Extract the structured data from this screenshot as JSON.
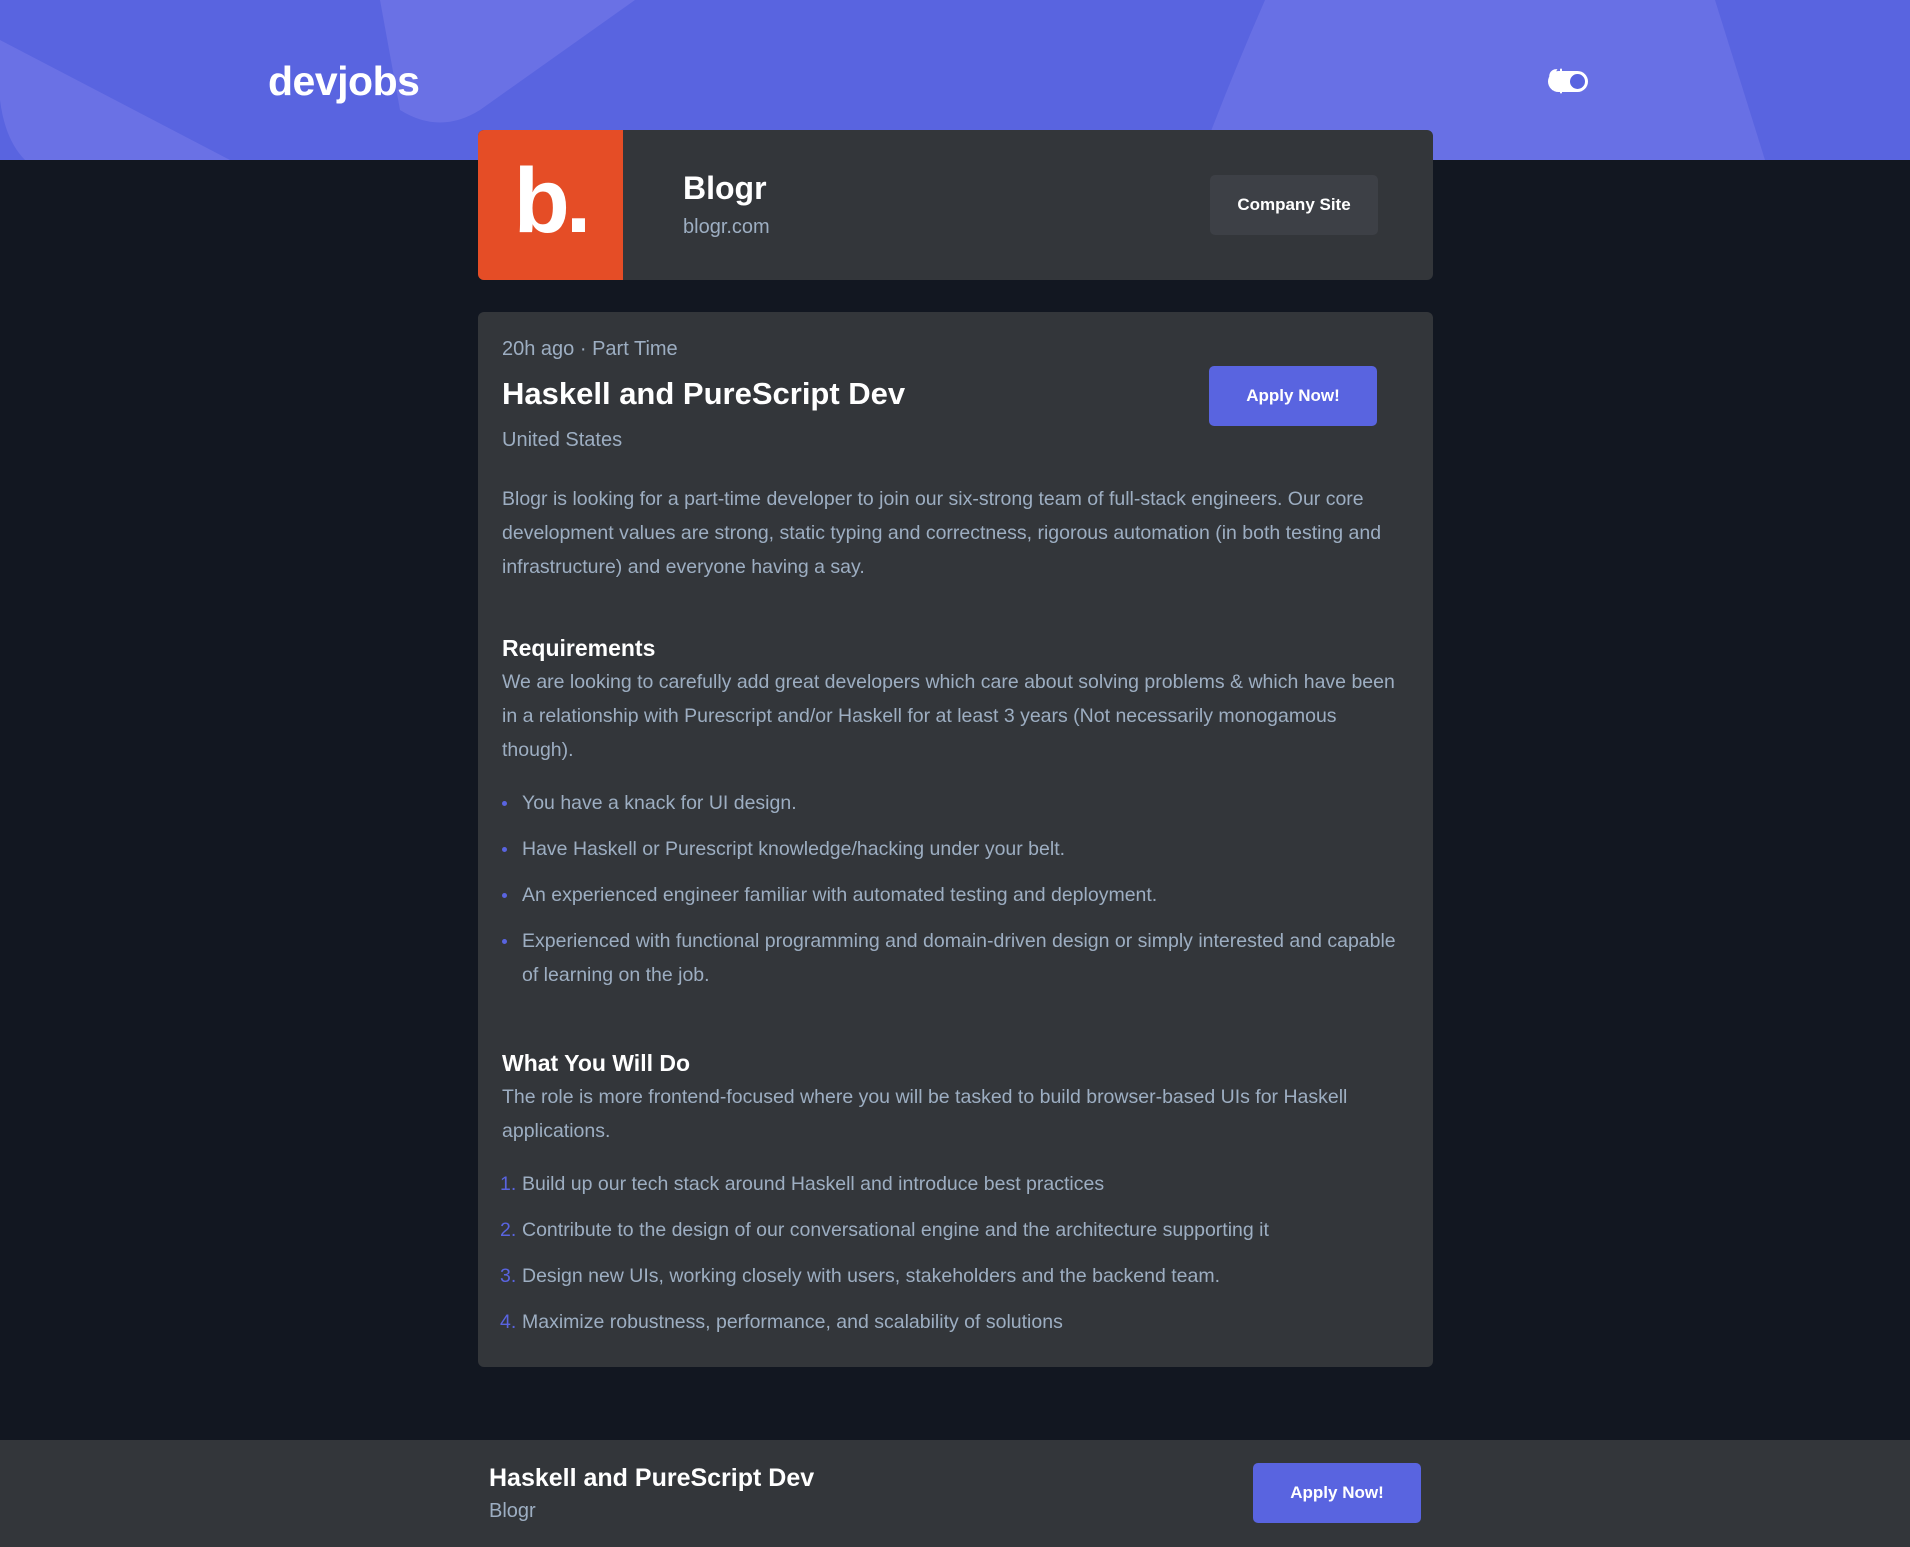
{
  "header": {
    "logo": "devjobs",
    "theme_icons": [
      "sun-icon",
      "moon-icon"
    ],
    "dark_mode": true
  },
  "company": {
    "logo_text": "b.",
    "logo_color": "#E54D26",
    "name": "Blogr",
    "site": "blogr.com",
    "site_button": "Company Site"
  },
  "job": {
    "posted_at": "20h ago",
    "separator": "·",
    "contract": "Part Time",
    "title": "Haskell and PureScript Dev",
    "location": "United States",
    "apply_label": "Apply Now!",
    "description": "Blogr is looking for a part-time developer to join our six-strong team of full-stack engineers. Our core development values are strong, static typing and correctness, rigorous automation (in both testing and infrastructure) and everyone having a say.",
    "requirements": {
      "title": "Requirements",
      "content": "We are looking to carefully add great developers which care about solving problems & which have been in a relationship with Purescript and/or Haskell for at least 3 years (Not necessarily monogamous though).",
      "items": [
        "You have a knack for UI design.",
        "Have Haskell or Purescript knowledge/hacking under your belt.",
        "An experienced engineer familiar with automated testing and deployment.",
        "Experienced with functional programming and domain-driven design or simply interested and capable of learning on the job."
      ]
    },
    "role": {
      "title": "What You Will Do",
      "content": "The role is more frontend-focused where you will be tasked to build browser-based UIs for Haskell applications.",
      "items": [
        "Build up our tech stack around Haskell and introduce best practices",
        "Contribute to the design of our conversational engine and the architecture supporting it",
        "Design new UIs, working closely with users, stakeholders and the backend team.",
        "Maximize robustness, performance, and scalability of solutions"
      ]
    }
  },
  "footer": {
    "title": "Haskell and PureScript Dev",
    "company": "Blogr",
    "apply_label": "Apply Now!"
  },
  "colors": {
    "accent": "#5964E0",
    "background": "#121721",
    "card": "#33363A"
  }
}
